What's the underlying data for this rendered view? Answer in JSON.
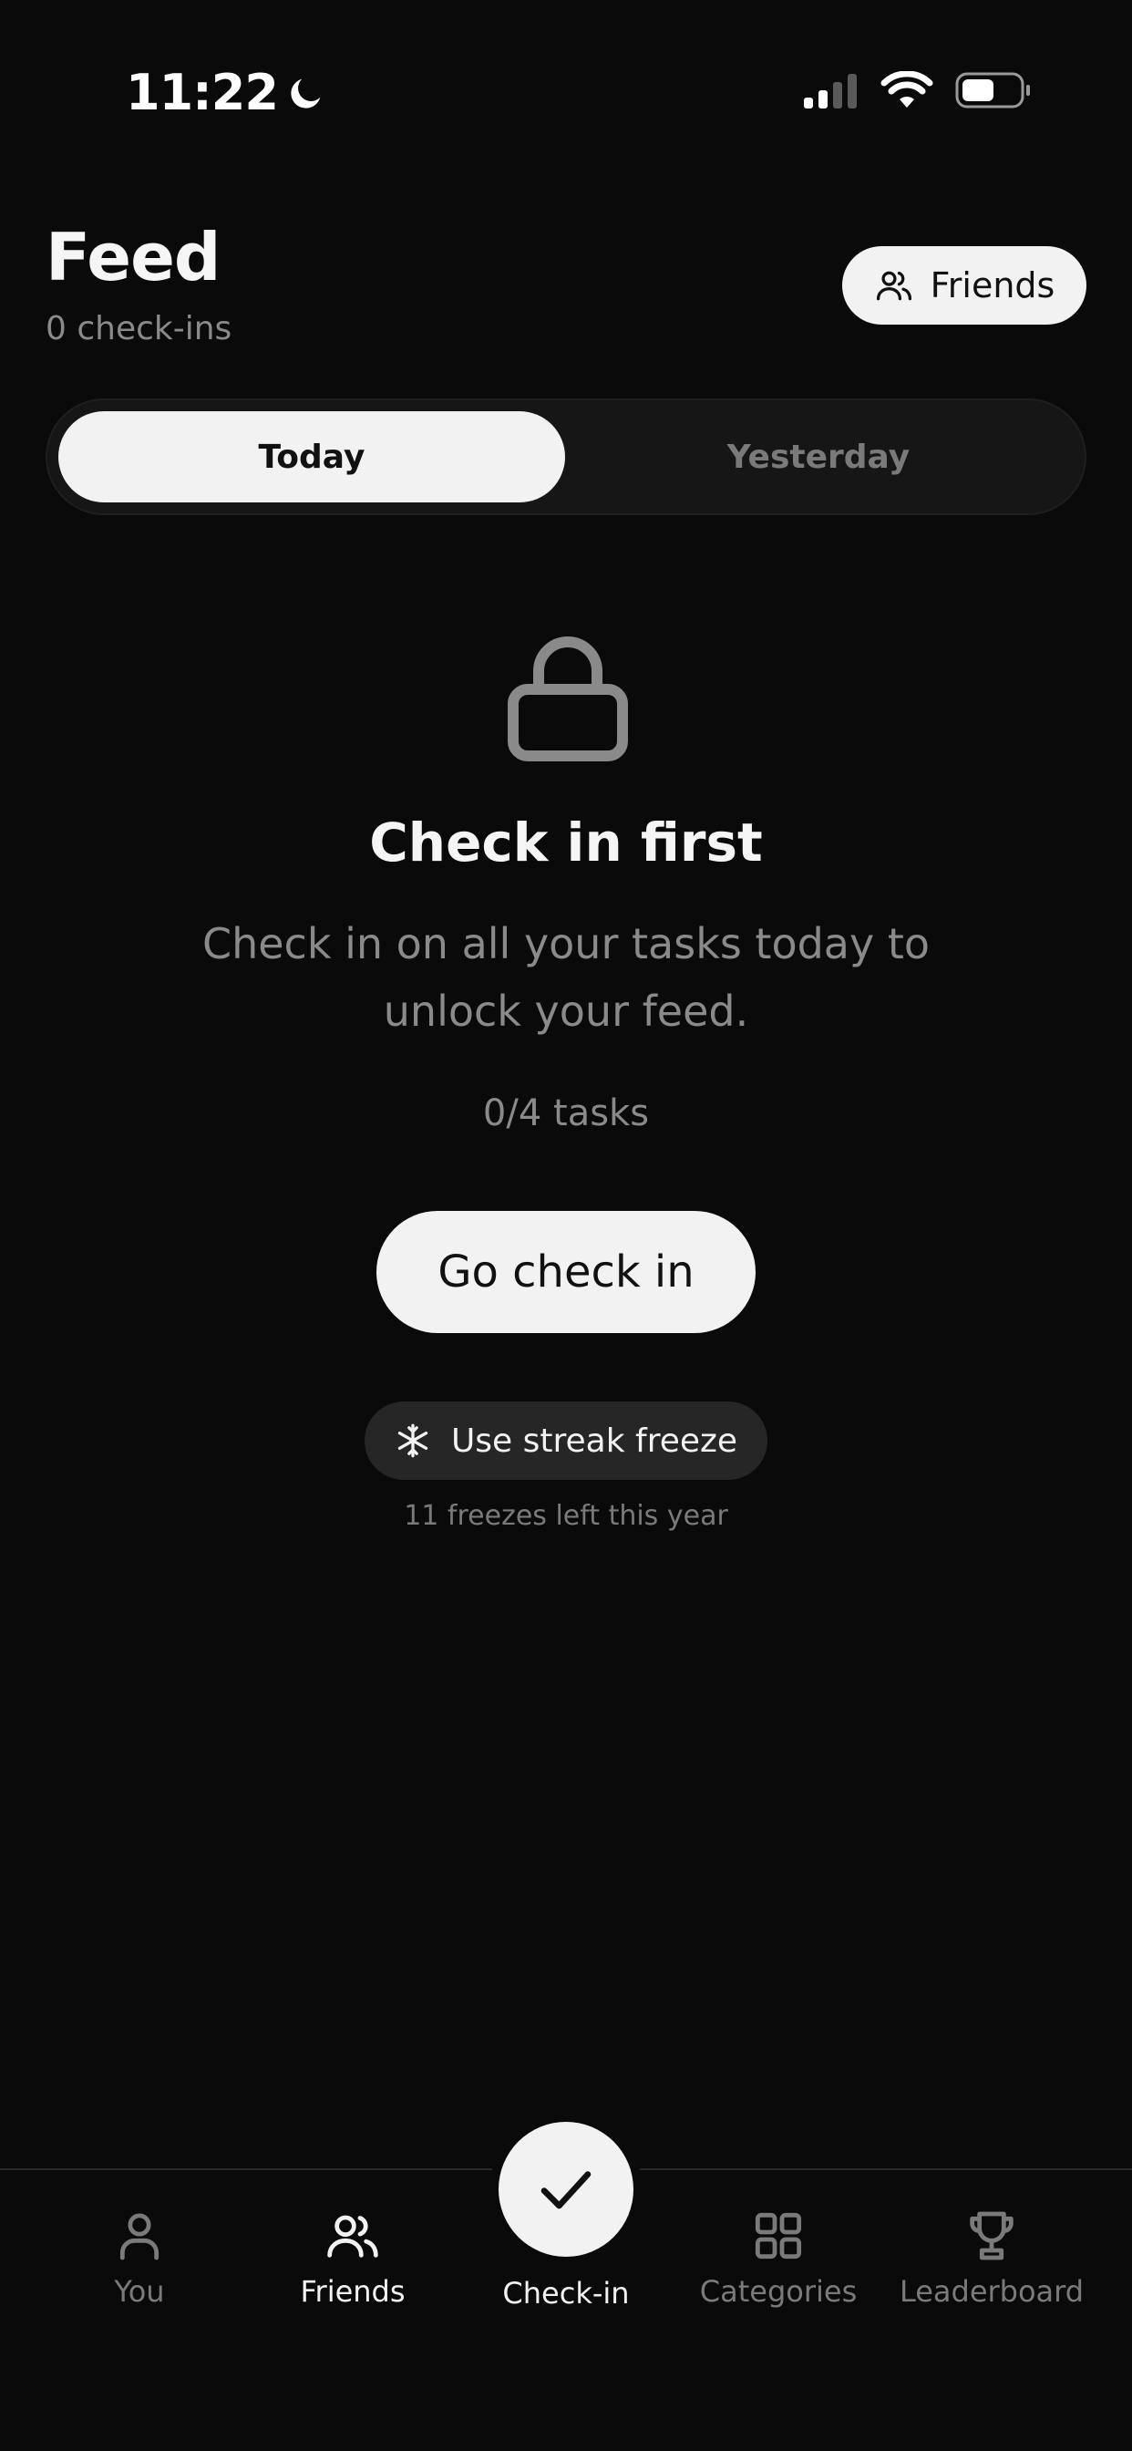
{
  "status_bar": {
    "time": "11:22"
  },
  "header": {
    "title": "Feed",
    "subtitle": "0 check-ins",
    "friends_button": "Friends"
  },
  "segments": {
    "active": "Today",
    "inactive": "Yesterday"
  },
  "empty_state": {
    "title": "Check in first",
    "description": "Check in on all your tasks today to unlock your feed.",
    "tasks": "0/4 tasks",
    "cta": "Go check in",
    "freeze_button": "Use streak freeze",
    "freeze_note": "11 freezes left this year"
  },
  "nav": {
    "items": [
      {
        "label": "You",
        "icon": "person-icon"
      },
      {
        "label": "Friends",
        "icon": "friends-icon",
        "active": true
      },
      {
        "label": "Check-in",
        "icon": "checkmark-icon"
      },
      {
        "label": "Categories",
        "icon": "grid-icon"
      },
      {
        "label": "Leaderboard",
        "icon": "trophy-icon"
      }
    ]
  },
  "colors": {
    "background": "#0a0a0a",
    "surface": "#161616",
    "primary_light": "#f2f2f2",
    "muted_text": "#8a8a8a"
  }
}
